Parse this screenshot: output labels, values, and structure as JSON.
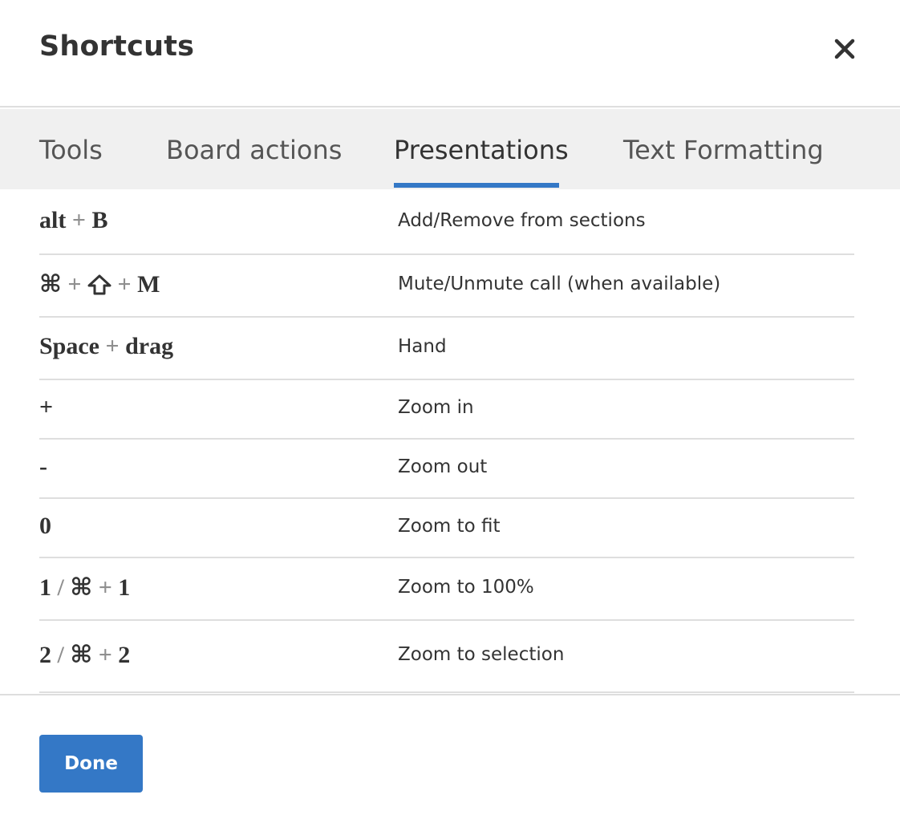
{
  "dialog": {
    "title": "Shortcuts",
    "close_icon": "close-icon",
    "done_label": "Done",
    "accent_color": "#3478c6"
  },
  "tabs": [
    {
      "label": "Tools",
      "active": false
    },
    {
      "label": "Board actions",
      "active": false
    },
    {
      "label": "Presentations",
      "active": true
    },
    {
      "label": "Text Formatting",
      "active": false
    }
  ],
  "shortcuts": [
    {
      "keys": [
        {
          "k": "alt"
        },
        {
          "s": "+"
        },
        {
          "k": "B"
        }
      ],
      "description": "Add/Remove from sections"
    },
    {
      "keys": [
        {
          "k": "⌘"
        },
        {
          "s": "+"
        },
        {
          "icon": "shift-icon"
        },
        {
          "s": "+"
        },
        {
          "k": "M"
        }
      ],
      "description": "Mute/Unmute call (when available)"
    },
    {
      "keys": [
        {
          "k": "Space"
        },
        {
          "s": "+"
        },
        {
          "k": "drag"
        }
      ],
      "description": "Hand"
    },
    {
      "keys": [
        {
          "k": "+"
        }
      ],
      "description": "Zoom in"
    },
    {
      "keys": [
        {
          "k": "-"
        }
      ],
      "description": "Zoom out"
    },
    {
      "keys": [
        {
          "k": "0"
        }
      ],
      "description": "Zoom to fit"
    },
    {
      "keys": [
        {
          "k": "1"
        },
        {
          "s": "/"
        },
        {
          "k": "⌘"
        },
        {
          "s": "+"
        },
        {
          "k": "1"
        }
      ],
      "description": "Zoom to 100%"
    },
    {
      "keys": [
        {
          "k": "2"
        },
        {
          "s": "/"
        },
        {
          "k": "⌘"
        },
        {
          "s": "+"
        },
        {
          "k": "2"
        }
      ],
      "description": "Zoom to selection"
    }
  ]
}
